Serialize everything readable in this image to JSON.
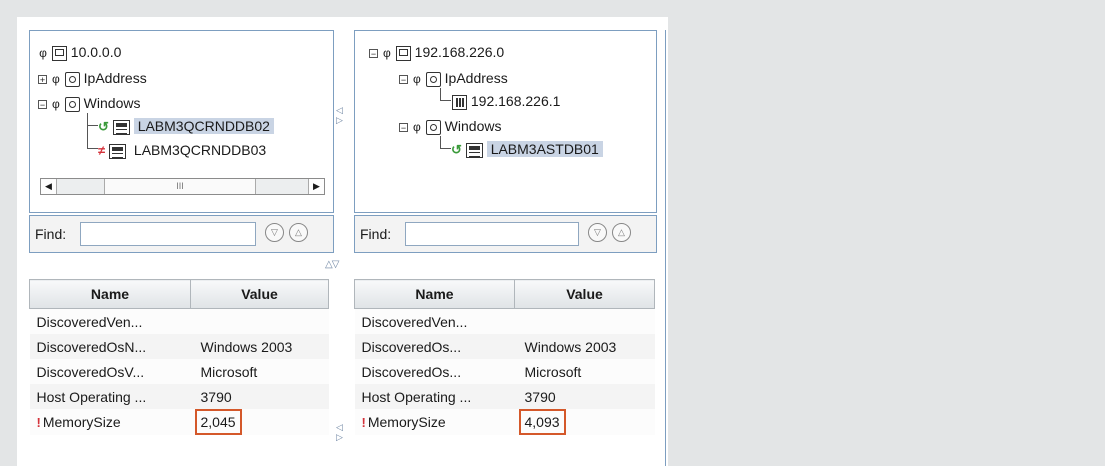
{
  "left_tree": {
    "root": "10.0.0.0",
    "ip_group": "IpAddress",
    "windows_group": "Windows",
    "host1": "LABM3QCRNDDB02",
    "host2": "LABM3QCRNDDB03",
    "scroll_thumb": "III",
    "scroll_left": "◀",
    "scroll_right": "▶"
  },
  "right_tree": {
    "root": "192.168.226.0",
    "ip_group": "IpAddress",
    "ip_addr": "192.168.226.1",
    "windows_group": "Windows",
    "host1": "LABM3ASTDB01"
  },
  "find": {
    "label": "Find:",
    "value": "",
    "down_glyph": "▽",
    "up_glyph": "△"
  },
  "splitters": {
    "vertical": "◁▷",
    "horizontal": "△▽"
  },
  "table": {
    "columns": [
      "Name",
      "Value"
    ]
  },
  "left_props": [
    {
      "name": "DiscoveredVen...",
      "value": ""
    },
    {
      "name": "DiscoveredOsN...",
      "value": "Windows 2003"
    },
    {
      "name": "DiscoveredOsV...",
      "value": "Microsoft"
    },
    {
      "name": "Host Operating ...",
      "value": "3790"
    },
    {
      "name": "MemorySize",
      "value": "2,045"
    }
  ],
  "right_props": [
    {
      "name": "DiscoveredVen...",
      "value": ""
    },
    {
      "name": "DiscoveredOs...",
      "value": "Windows 2003"
    },
    {
      "name": "DiscoveredOs...",
      "value": "Microsoft"
    },
    {
      "name": "Host Operating ...",
      "value": "3790"
    },
    {
      "name": "MemorySize",
      "value": "4,093"
    }
  ],
  "markers": {
    "diff_mark": "!",
    "compare_symbol": "φ",
    "match_arrow": "↺",
    "mismatch_arrow": "≠"
  },
  "colors": {
    "selection": "#c9d4e4",
    "highlight_border": "#d4582a",
    "panel_border": "#7d9ec0",
    "diff_mark": "#d4323a",
    "match_green": "#3a9a3a",
    "mismatch_red": "#d4323a"
  }
}
